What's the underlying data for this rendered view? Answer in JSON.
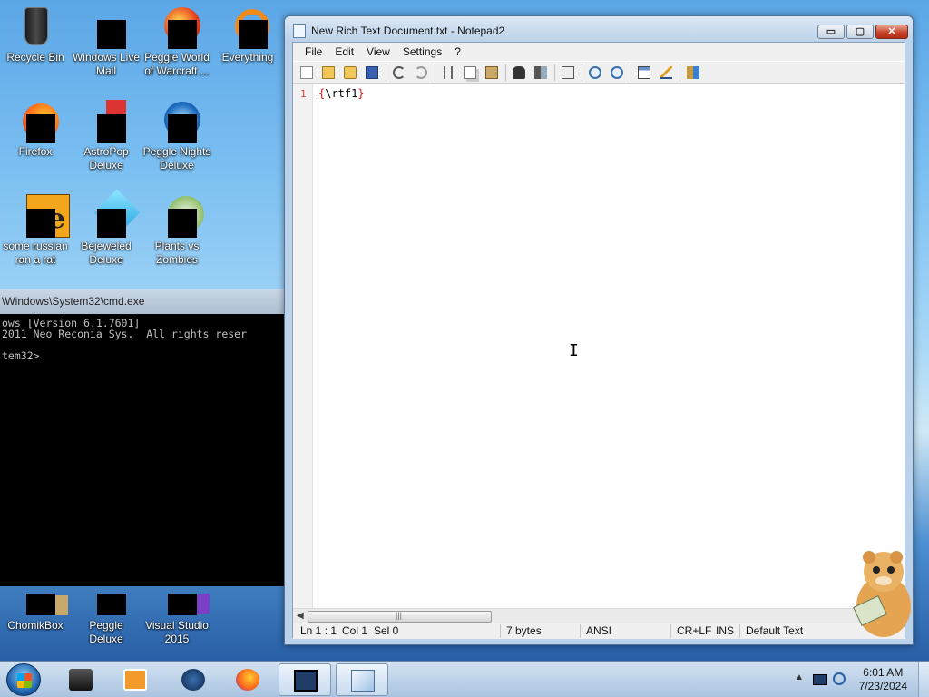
{
  "desktop": {
    "icons": [
      {
        "label": "Recycle Bin",
        "icon": "recycle-bin-icon"
      },
      {
        "label": "Windows Live Mail",
        "icon": "mail-icon"
      },
      {
        "label": "Peggle World of Warcraft ...",
        "icon": "peggle-icon"
      },
      {
        "label": "Everything",
        "icon": "everything-icon"
      },
      {
        "label": "Firefox",
        "icon": "firefox-icon"
      },
      {
        "label": "AstroPop Deluxe",
        "icon": "astropop-icon"
      },
      {
        "label": "Peggle Nights Deluxe",
        "icon": "peggle-nights-icon"
      },
      {
        "label": "some russian ran a rat",
        "icon": "rat-icon"
      },
      {
        "label": "Bejeweled Deluxe",
        "icon": "bejeweled-icon"
      },
      {
        "label": "Plants vs Zombies",
        "icon": "plants-vs-zombies-icon"
      },
      {
        "label": "ChomikBox",
        "icon": "chomikbox-icon"
      },
      {
        "label": "Peggle Deluxe",
        "icon": "peggle-deluxe-icon"
      },
      {
        "label": "Visual Studio 2015",
        "icon": "visual-studio-icon"
      }
    ]
  },
  "cmd": {
    "title": "\\Windows\\System32\\cmd.exe",
    "lines": [
      "ows [Version 6.1.7601]",
      "2011 Neo Reconia Sys.  All rights reser",
      "",
      "tem32>"
    ]
  },
  "notepad": {
    "title": "New Rich Text Document.txt - Notepad2",
    "controls": {
      "minimize": "▭",
      "maximize": "▢",
      "close": "✕"
    },
    "menu": [
      "File",
      "Edit",
      "View",
      "Settings",
      "?"
    ],
    "toolbar": [
      "new-icon",
      "open-icon",
      "browse-icon",
      "save-icon",
      "undo-icon",
      "redo-icon",
      "cut-icon",
      "copy-icon",
      "paste-icon",
      "find-icon",
      "replace-icon",
      "word-wrap-icon",
      "zoom-in-icon",
      "zoom-out-icon",
      "scheme-icon",
      "customize-icon",
      "exit-icon"
    ],
    "line_number": "1",
    "content": {
      "open_brace": "{",
      "body": "\\rtf1",
      "close_brace": "}"
    },
    "hscroll_grip": "|||",
    "status": {
      "position": "Ln 1 : 1",
      "column": "Col 1",
      "selection": "Sel 0",
      "size": "7 bytes",
      "encoding": "ANSI",
      "eol": "CR+LF",
      "mode": "INS",
      "scheme": "Default Text"
    }
  },
  "taskbar": {
    "items": [
      "file-explorer-icon",
      "media-player-icon",
      "globe-icon",
      "firefox-icon",
      "cmd-icon",
      "notepad2-icon"
    ],
    "clock": {
      "time": "6:01 AM",
      "date": "7/23/2024"
    }
  },
  "colors": {
    "brace": "#dd1111",
    "line_number": "#cc4433",
    "accent": "#1c5fa8"
  }
}
